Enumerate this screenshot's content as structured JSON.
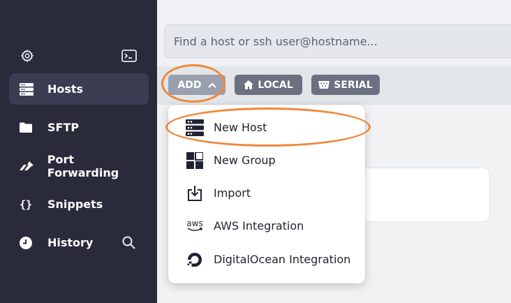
{
  "sidebar": {
    "top_icons": [
      {
        "name": "settings",
        "icon": "gear-icon"
      },
      {
        "name": "terminal",
        "icon": "terminal-icon"
      }
    ],
    "items": [
      {
        "label": "Hosts",
        "icon": "server-icon",
        "active": true
      },
      {
        "label": "SFTP",
        "icon": "folder-icon",
        "active": false
      },
      {
        "label": "Port Forwarding",
        "icon": "port-forwarding-icon",
        "active": false
      },
      {
        "label": "Snippets",
        "icon": "braces-icon",
        "active": false
      },
      {
        "label": "History",
        "icon": "clock-icon",
        "active": false
      }
    ],
    "history_search_icon": "search-icon"
  },
  "search": {
    "placeholder": "Find a host or ssh user@hostname..."
  },
  "toolbar": {
    "add_label": "ADD",
    "local_label": "LOCAL",
    "serial_label": "SERIAL"
  },
  "add_menu": {
    "items": [
      {
        "label": "New Host",
        "icon": "server-icon"
      },
      {
        "label": "New Group",
        "icon": "group-icon"
      },
      {
        "label": "Import",
        "icon": "import-icon"
      },
      {
        "label": "AWS Integration",
        "icon": "aws-icon",
        "icon_text": "aws"
      },
      {
        "label": "DigitalOcean Integration",
        "icon": "digitalocean-icon"
      }
    ]
  },
  "colors": {
    "sidebar_bg": "#292b3b",
    "sidebar_active": "#3a3d51",
    "accent_annotation": "#f0883a",
    "pill": "#6c7181",
    "pill_add": "#9aa0ae"
  }
}
